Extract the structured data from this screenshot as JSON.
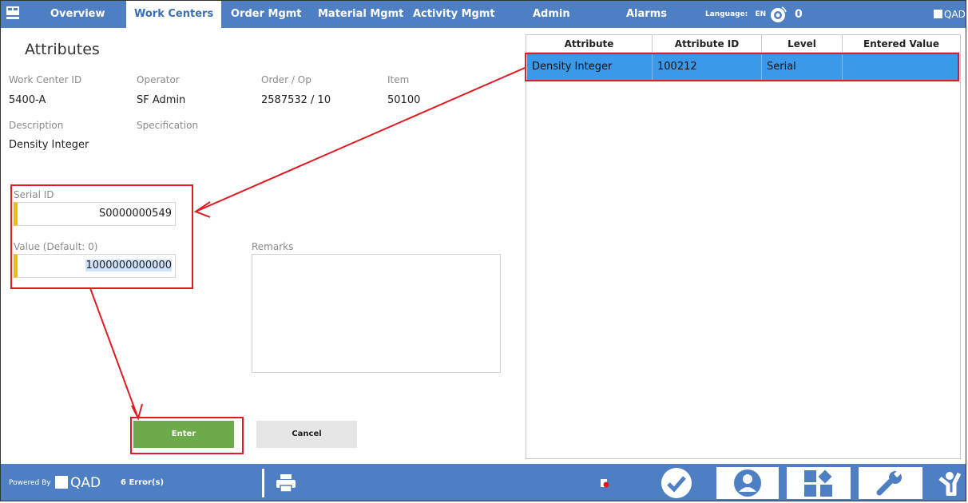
{
  "nav": {
    "items": [
      "Overview",
      "Work Centers",
      "Order Mgmt",
      "Material Mgmt",
      "Activity Mgmt",
      "Admin",
      "Alarms"
    ],
    "active": "Work Centers",
    "language_label": "Language:",
    "language_value": "EN",
    "alarm_count": "0",
    "brand": "QAD",
    "icons": {
      "logo": "workstation-icon",
      "alarm": "alarm-signal-icon"
    }
  },
  "attributes": {
    "title": "Attributes",
    "fields": {
      "work_center_id": {
        "label": "Work Center ID",
        "value": "5400-A"
      },
      "operator": {
        "label": "Operator",
        "value": "SF Admin"
      },
      "order_op": {
        "label": "Order / Op",
        "value": "2587532 / 10"
      },
      "item": {
        "label": "Item",
        "value": "50100"
      },
      "description": {
        "label": "Description",
        "value": "Density Integer"
      },
      "specification": {
        "label": "Specification",
        "value": ""
      }
    },
    "serial_id": {
      "label": "Serial ID",
      "value": "S0000000549"
    },
    "value_field": {
      "label": "Value (Default: 0)",
      "value": "1000000000000"
    },
    "remarks": {
      "label": "Remarks",
      "value": ""
    },
    "enter_label": "Enter",
    "cancel_label": "Cancel"
  },
  "table": {
    "columns": [
      "Attribute",
      "Attribute ID",
      "Level",
      "Entered Value"
    ],
    "rows": [
      {
        "attribute": "Density Integer",
        "attribute_id": "100212",
        "level": "Serial",
        "entered_value": ""
      }
    ]
  },
  "footer": {
    "powered_by": "Powered By",
    "brand": "QAD",
    "errors": "6 Error(s)",
    "icons": [
      "print-icon",
      "error-indicator-icon",
      "checkmark-icon",
      "user-icon",
      "dashboard-icon",
      "wrench-icon",
      "operator-icon"
    ]
  },
  "colors": {
    "nav_blue": "#4f7fc3",
    "selected_row": "#3a99e8",
    "enter_green": "#6cab4a",
    "required_marker": "#f3b90e",
    "annotation_red": "#e01b22"
  }
}
